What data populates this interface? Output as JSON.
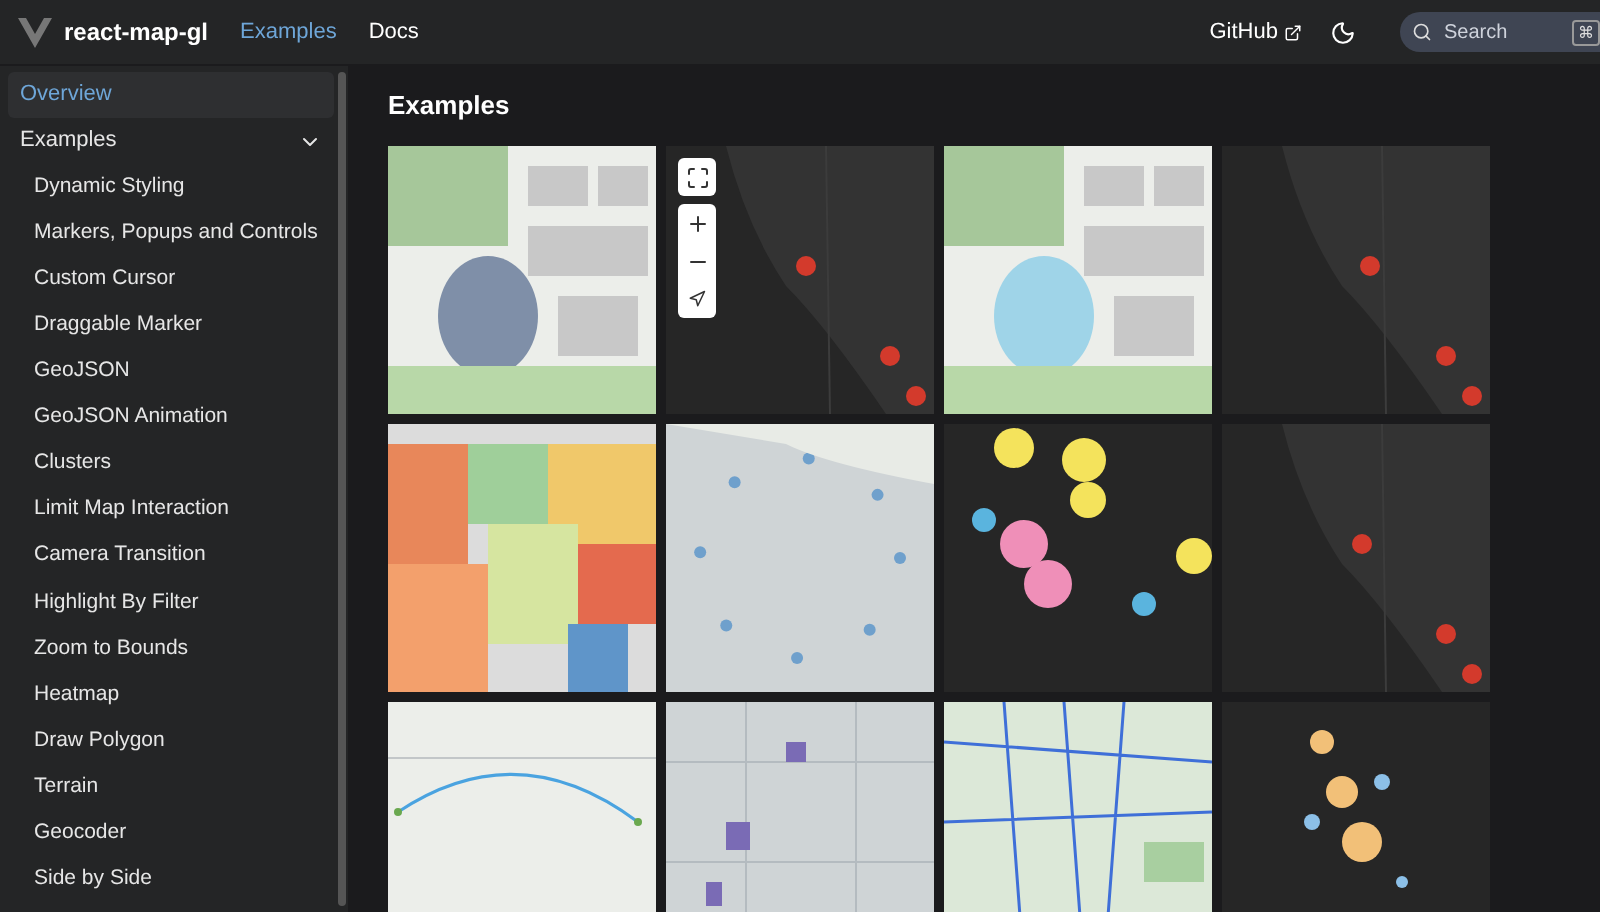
{
  "header": {
    "logo_text": "react-map-gl",
    "nav": [
      {
        "label": "Examples",
        "selected": true
      },
      {
        "label": "Docs",
        "selected": false
      }
    ],
    "github": "GitHub",
    "search": {
      "placeholder": "Search",
      "keys": [
        "⌘"
      ]
    }
  },
  "sidebar": {
    "items": [
      {
        "label": "Overview",
        "selected": true
      },
      {
        "label": "Examples",
        "selected": false,
        "expanded": true,
        "children": [
          {
            "label": "Dynamic Styling",
            "selected": false
          },
          {
            "label": "Markers, Popups and Controls",
            "selected": false
          },
          {
            "label": "Custom Cursor",
            "selected": false
          },
          {
            "label": "Draggable Marker",
            "selected": false
          },
          {
            "label": "GeoJSON",
            "selected": false
          },
          {
            "label": "GeoJSON Animation",
            "selected": false
          },
          {
            "label": "Clusters",
            "selected": false
          },
          {
            "label": "Limit Map Interaction",
            "selected": false
          },
          {
            "label": "Camera Transition",
            "selected": false
          },
          {
            "label": "Highlight By Filter",
            "selected": false
          },
          {
            "label": "Zoom to Bounds",
            "selected": false
          },
          {
            "label": "Heatmap",
            "selected": false
          },
          {
            "label": "Draw Polygon",
            "selected": false
          },
          {
            "label": "Terrain",
            "selected": false
          },
          {
            "label": "Geocoder",
            "selected": false
          },
          {
            "label": "Side by Side",
            "selected": false
          }
        ]
      }
    ]
  },
  "main": {
    "title": "Examples",
    "thumbnails": [
      {
        "kind": "picture"
      },
      {
        "kind": "picture",
        "map_controls": true
      },
      {
        "kind": "picture"
      },
      {
        "kind": "picture"
      },
      {
        "kind": "picture"
      },
      {
        "kind": "picture"
      },
      {
        "kind": "picture"
      },
      {
        "kind": "picture"
      },
      {
        "kind": "picture"
      },
      {
        "kind": "picture"
      },
      {
        "kind": "picture"
      },
      {
        "kind": "picture"
      }
    ]
  }
}
